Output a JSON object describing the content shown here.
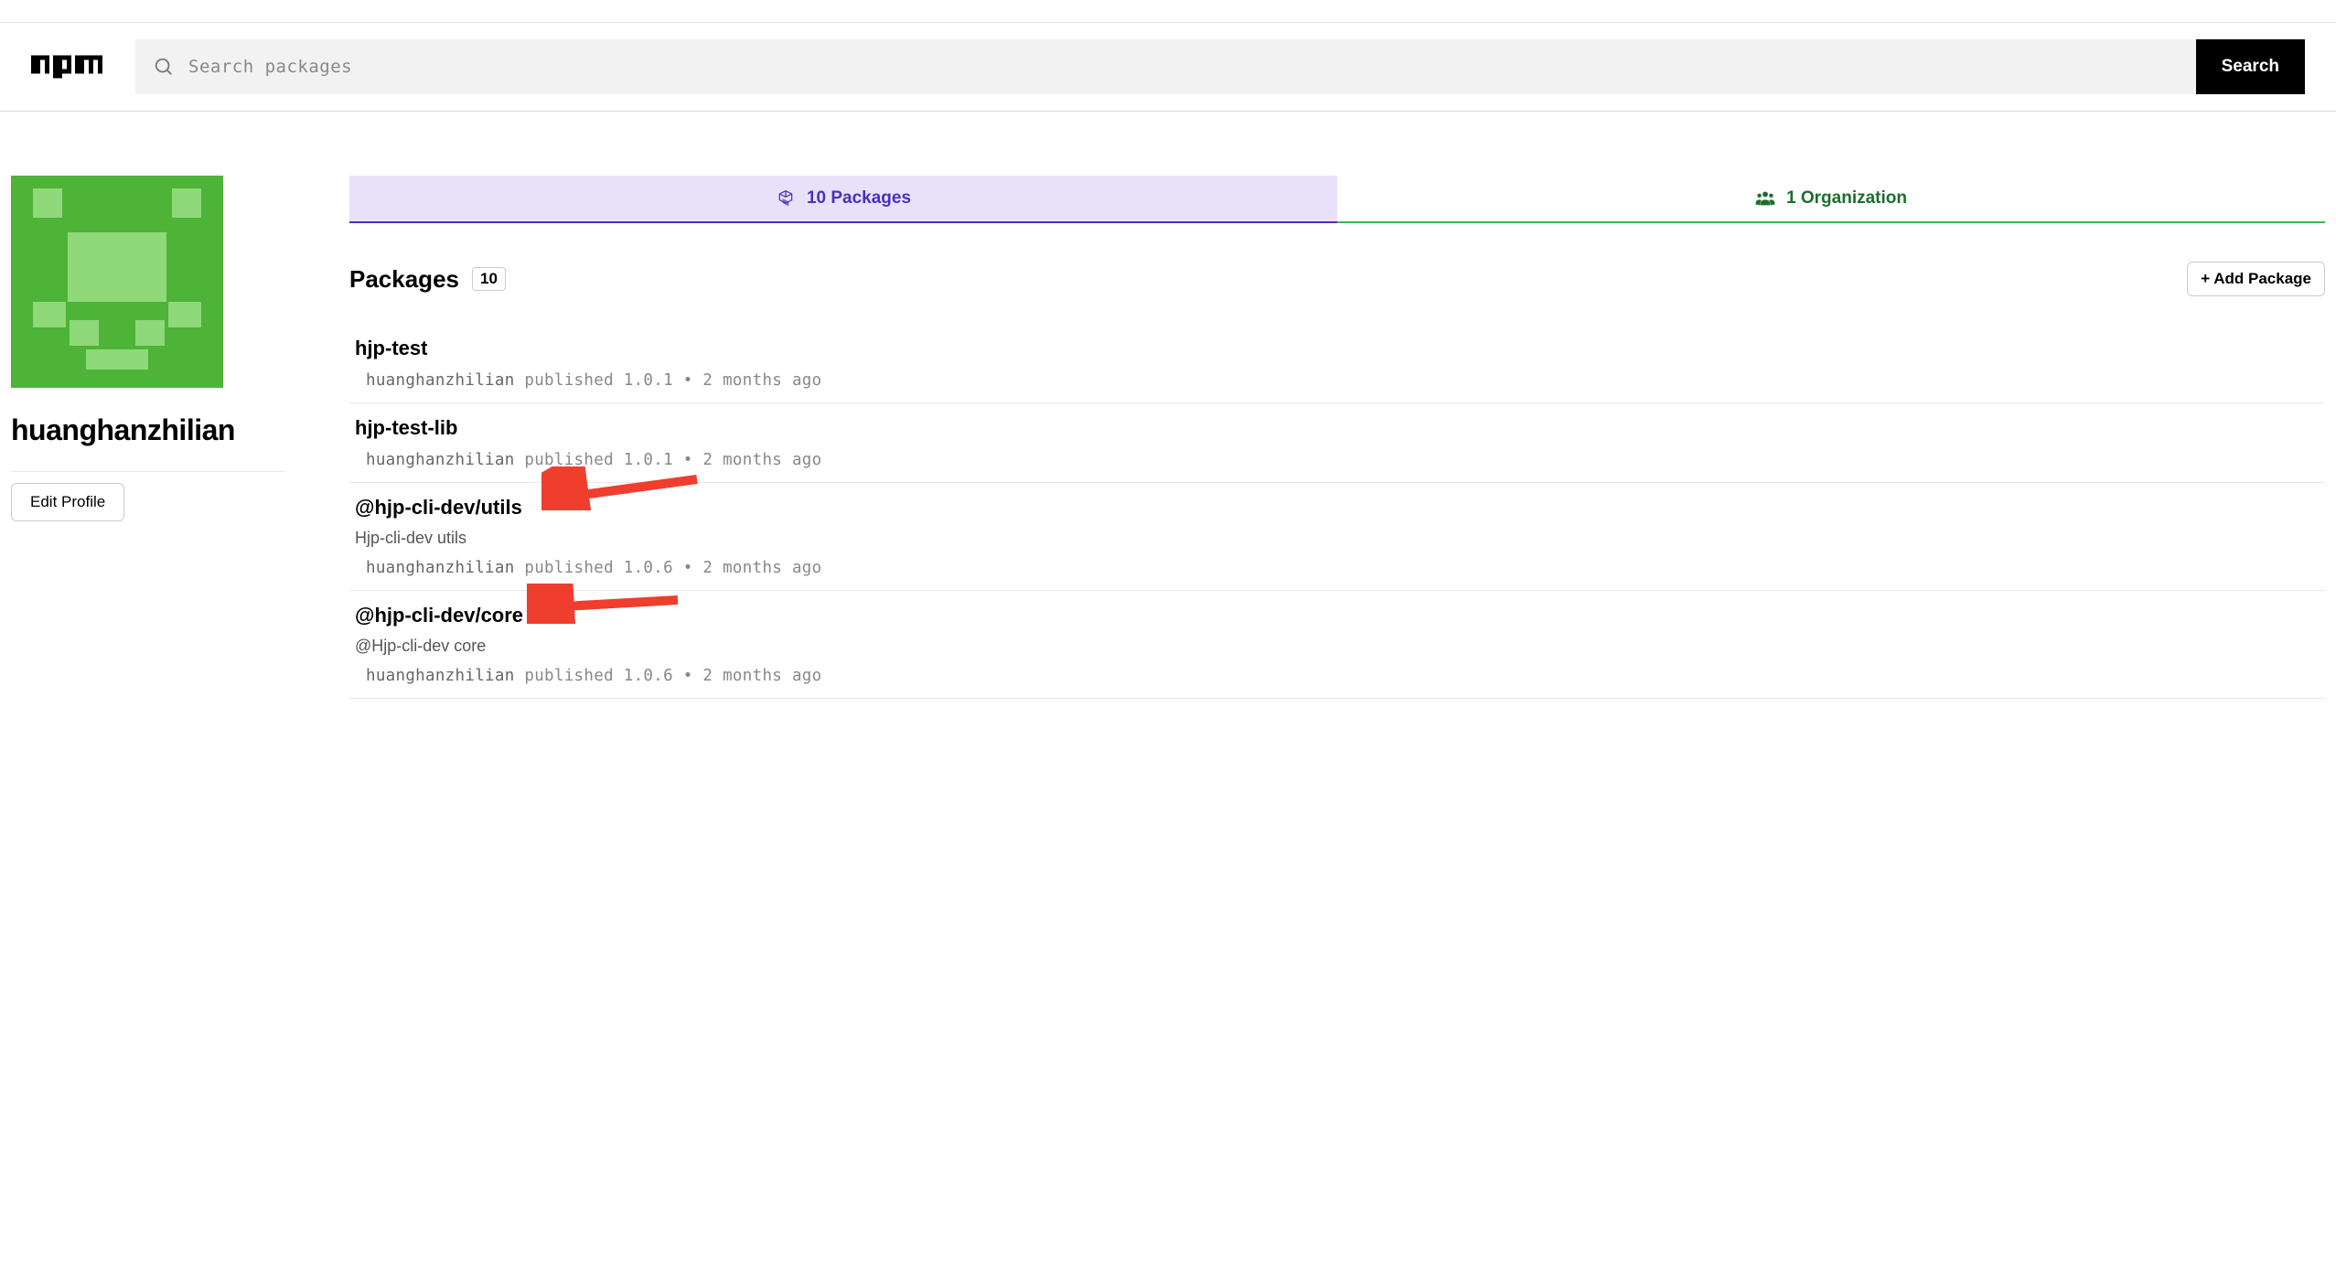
{
  "header": {
    "search_placeholder": "Search packages",
    "search_button": "Search"
  },
  "profile": {
    "username": "huanghanzhilian",
    "edit_profile": "Edit Profile"
  },
  "tabs": {
    "packages_label": "10 Packages",
    "org_label": "1 Organization"
  },
  "packages_section": {
    "title": "Packages",
    "count": "10",
    "add_button": "+ Add Package"
  },
  "packages": [
    {
      "name": "hjp-test",
      "author": "huanghanzhilian",
      "meta_rest": " published 1.0.1 • 2 months ago"
    },
    {
      "name": "hjp-test-lib",
      "author": "huanghanzhilian",
      "meta_rest": " published 1.0.1 • 2 months ago"
    },
    {
      "name": "@hjp-cli-dev/utils",
      "description": "Hjp-cli-dev utils",
      "author": "huanghanzhilian",
      "meta_rest": " published 1.0.6 • 2 months ago"
    },
    {
      "name": "@hjp-cli-dev/core",
      "description": "@Hjp-cli-dev core",
      "author": "huanghanzhilian",
      "meta_rest": " published 1.0.6 • 2 months ago"
    }
  ]
}
